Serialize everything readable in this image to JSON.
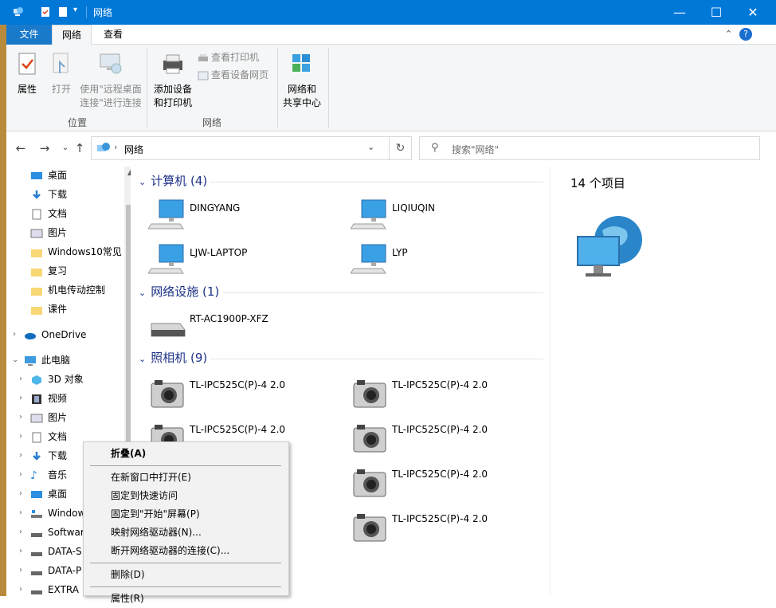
{
  "window": {
    "title": "网络",
    "controls": {
      "minimize": "—",
      "maximize": "☐",
      "close": "✕"
    }
  },
  "tabs": [
    {
      "label": "文件"
    },
    {
      "label": "网络"
    },
    {
      "label": "查看"
    }
  ],
  "ribbon": {
    "location_group": {
      "label": "位置",
      "properties": "属性",
      "open": "打开",
      "remote_desktop_line1": "使用\"远程桌面",
      "remote_desktop_line2": "连接\"进行连接"
    },
    "network_group": {
      "label": "网络",
      "add_device_line1": "添加设备",
      "add_device_line2": "和打印机",
      "view_printers": "查看打印机",
      "view_device_webpage": "查看设备网页"
    },
    "sharing_center_line1": "网络和",
    "sharing_center_line2": "共享中心"
  },
  "address": {
    "path": "网络",
    "search_placeholder": "搜索\"网络\""
  },
  "nav_pane": {
    "quick_access": [
      {
        "label": "桌面",
        "pinned": true
      },
      {
        "label": "下载",
        "pinned": true
      },
      {
        "label": "文档",
        "pinned": true
      },
      {
        "label": "图片",
        "pinned": true
      },
      {
        "label": "Windows10常见"
      },
      {
        "label": "复习"
      },
      {
        "label": "机电传动控制"
      },
      {
        "label": "课件"
      }
    ],
    "onedrive": "OneDrive",
    "this_pc": "此电脑",
    "pc_items": [
      {
        "label": "3D 对象"
      },
      {
        "label": "视频"
      },
      {
        "label": "图片"
      },
      {
        "label": "文档"
      },
      {
        "label": "下载"
      },
      {
        "label": "音乐"
      },
      {
        "label": "桌面"
      },
      {
        "label": "Windows"
      },
      {
        "label": "Software"
      },
      {
        "label": "DATA-S"
      },
      {
        "label": "DATA-P"
      },
      {
        "label": "EXTRA"
      }
    ]
  },
  "groups": {
    "computers": {
      "header": "计算机 (4)",
      "items": [
        "DINGYANG",
        "LIQIUQIN",
        "LJW-LAPTOP",
        "LYP"
      ]
    },
    "network_infra": {
      "header": "网络设施 (1)",
      "items": [
        "RT-AC1900P-XFZ"
      ]
    },
    "cameras": {
      "header": "照相机 (9)",
      "items": [
        "TL-IPC525C(P)-4 2.0",
        "TL-IPC525C(P)-4 2.0",
        "TL-IPC525C(P)-4 2.0",
        "TL-IPC525C(P)-4 2.0",
        "TL-IPC525C(P)-4 2.0",
        "TL-IPC525C(P)-4 2.0"
      ]
    }
  },
  "details": {
    "item_count": "14 个项目"
  },
  "context_menu": {
    "collapse": "折叠(A)",
    "open_new_window": "在新窗口中打开(E)",
    "pin_quick_access": "固定到快速访问",
    "pin_start": "固定到\"开始\"屏幕(P)",
    "map_drive": "映射网络驱动器(N)...",
    "disconnect_drive": "断开网络驱动器的连接(C)...",
    "delete": "删除(D)",
    "properties": "属性(R)"
  }
}
